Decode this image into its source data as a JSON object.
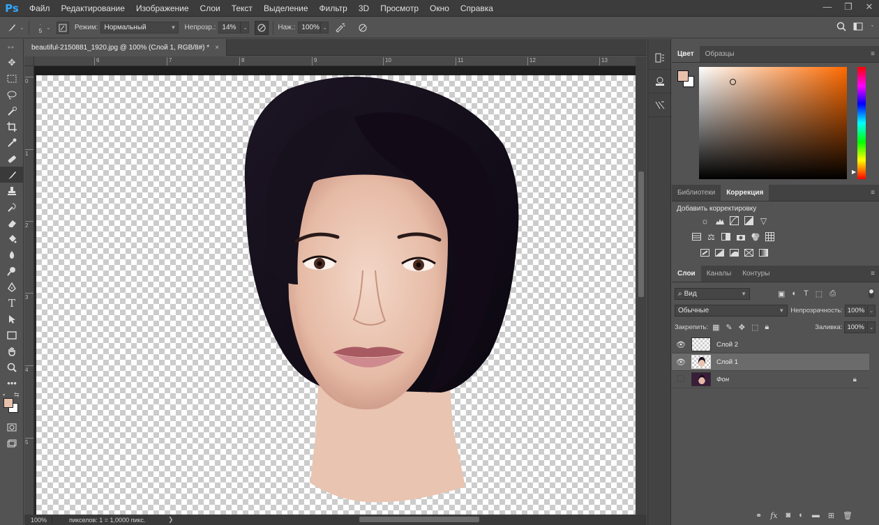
{
  "app": {
    "logo": "Ps"
  },
  "menu": [
    "Файл",
    "Редактирование",
    "Изображение",
    "Слои",
    "Текст",
    "Выделение",
    "Фильтр",
    "3D",
    "Просмотр",
    "Окно",
    "Справка"
  ],
  "window_controls": {
    "minimize": "—",
    "restore": "❐",
    "close": "✕"
  },
  "options": {
    "brush_size": "5",
    "mode_label": "Режим:",
    "mode_value": "Нормальный",
    "opacity_label": "Непрозр.:",
    "opacity_value": "14%",
    "pressure_label": "Наж.:",
    "pressure_value": "100%"
  },
  "document": {
    "tab_title": "beautiful-2150881_1920.jpg @ 100% (Слой 1, RGB/8#) *",
    "close": "×"
  },
  "rulers": {
    "horizontal": [
      "6",
      "7",
      "8",
      "9",
      "10",
      "11",
      "12",
      "13"
    ],
    "vertical": [
      "0",
      "1",
      "2",
      "3",
      "4",
      "5"
    ]
  },
  "status": {
    "zoom": "100%",
    "info": "пикселов: 1 = 1,0000 пикс.",
    "arrow": "❯"
  },
  "color_panel": {
    "tabs": [
      "Цвет",
      "Образцы"
    ],
    "foreground": "#e8c1ad",
    "background": "#ffffff"
  },
  "adjust_panel": {
    "tabs": [
      "Библиотеки",
      "Коррекция"
    ],
    "title": "Добавить корректировку"
  },
  "layers_panel": {
    "tabs": [
      "Слои",
      "Каналы",
      "Контуры"
    ],
    "filter_value": "Вид",
    "blend_mode": "Обычные",
    "opacity_label": "Непрозрачность:",
    "opacity_value": "100%",
    "lock_label": "Закрепить:",
    "fill_label": "Заливка:",
    "fill_value": "100%",
    "layers": [
      {
        "name": "Слой 2",
        "visible": true,
        "selected": false
      },
      {
        "name": "Слой 1",
        "visible": true,
        "selected": true
      },
      {
        "name": "Фон",
        "visible": false,
        "selected": false,
        "locked": true
      }
    ]
  }
}
